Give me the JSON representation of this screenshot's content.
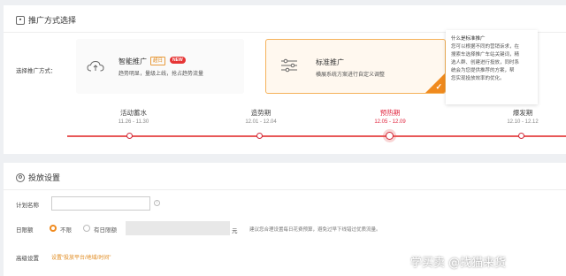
{
  "promo_section": {
    "title": "推广方式选择",
    "select_label": "选择推广方式：",
    "smart": {
      "title": "智能推广",
      "hot_tag": "超日",
      "new_tag": "NEW",
      "desc": "趋势明显，量级上线，抢占趋势流量"
    },
    "standard": {
      "title": "标准推广",
      "desc": "横展系统方案进行自定义调整"
    },
    "tooltip": {
      "title": "什么是标准推广",
      "lines": [
        "您可以根据不同的营销诉求，在",
        "搜索车选择推广车站关键词，精",
        "选人群、创建进行投放，同时系",
        "统会为您提供推荐的方案，帮",
        "您实现投放效率的优化。"
      ]
    },
    "timeline": [
      {
        "name": "活动蓄水",
        "date": "11.26 - 11.30"
      },
      {
        "name": "造势期",
        "date": "12.01 - 12.04"
      },
      {
        "name": "预热期",
        "date": "12.05 - 12.09"
      },
      {
        "name": "爆发期",
        "date": "12.10 - 12.12"
      }
    ]
  },
  "launch_section": {
    "title": "投放设置",
    "plan_name_label": "计划名称",
    "plan_name_value": "",
    "daily_budget_label": "日限额",
    "budget_options": [
      "不限",
      "有日限额"
    ],
    "unit": "元",
    "budget_hint": "建议您合理设置每日花费预算，避免过早下线错过优质流量。",
    "advanced_label": "高级设置",
    "advanced_link": "设置“投放平台/地域/时间”"
  },
  "watermark": "学买卖 @找猫来货",
  "colors": {
    "accent": "#f08a1e",
    "timeline_red": "#e0263f"
  }
}
